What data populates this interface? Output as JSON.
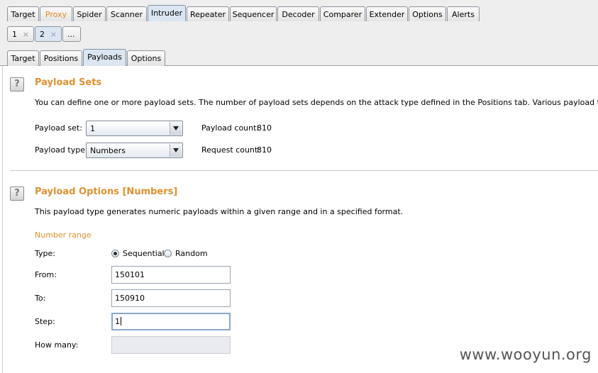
{
  "main_tabs": [
    "Target",
    "Proxy",
    "Spider",
    "Scanner",
    "Intruder",
    "Repeater",
    "Sequencer",
    "Decoder",
    "Comparer",
    "Extender",
    "Options",
    "Alerts"
  ],
  "attack_tabs": [
    {
      "label": "1",
      "close": "×"
    },
    {
      "label": "2",
      "close": "×"
    },
    {
      "label": "..."
    }
  ],
  "intruder_tabs": [
    "Target",
    "Positions",
    "Payloads",
    "Options"
  ],
  "payload_sets": {
    "help": "?",
    "title": "Payload Sets",
    "description": "You can define one or more payload sets. The number of payload sets depends on the attack type defined in the Positions tab. Various payload types are available fo",
    "set_label": "Payload set:",
    "set_value": "1",
    "type_label": "Payload type:",
    "type_value": "Numbers",
    "count_label": "Payload count:",
    "count_value": "810",
    "request_label": "Request count:",
    "request_value": "810"
  },
  "payload_options": {
    "help": "?",
    "title": "Payload Options [Numbers]",
    "description": "This payload type generates numeric payloads within a given range and in a specified format.",
    "range_heading": "Number range",
    "type_label": "Type:",
    "sequential_label": "Sequential",
    "random_label": "Random",
    "selected_type": "Sequential",
    "from_label": "From:",
    "from_value": "150101",
    "to_label": "To:",
    "to_value": "150910",
    "step_label": "Step:",
    "step_value": "1",
    "howmany_label": "How many:",
    "howmany_value": ""
  },
  "watermark": "www.wooyun.org",
  "colors": {
    "accent": "#e1912f",
    "proxy_tab": "#e58a1f",
    "active_tab": "#dbe6f2"
  }
}
